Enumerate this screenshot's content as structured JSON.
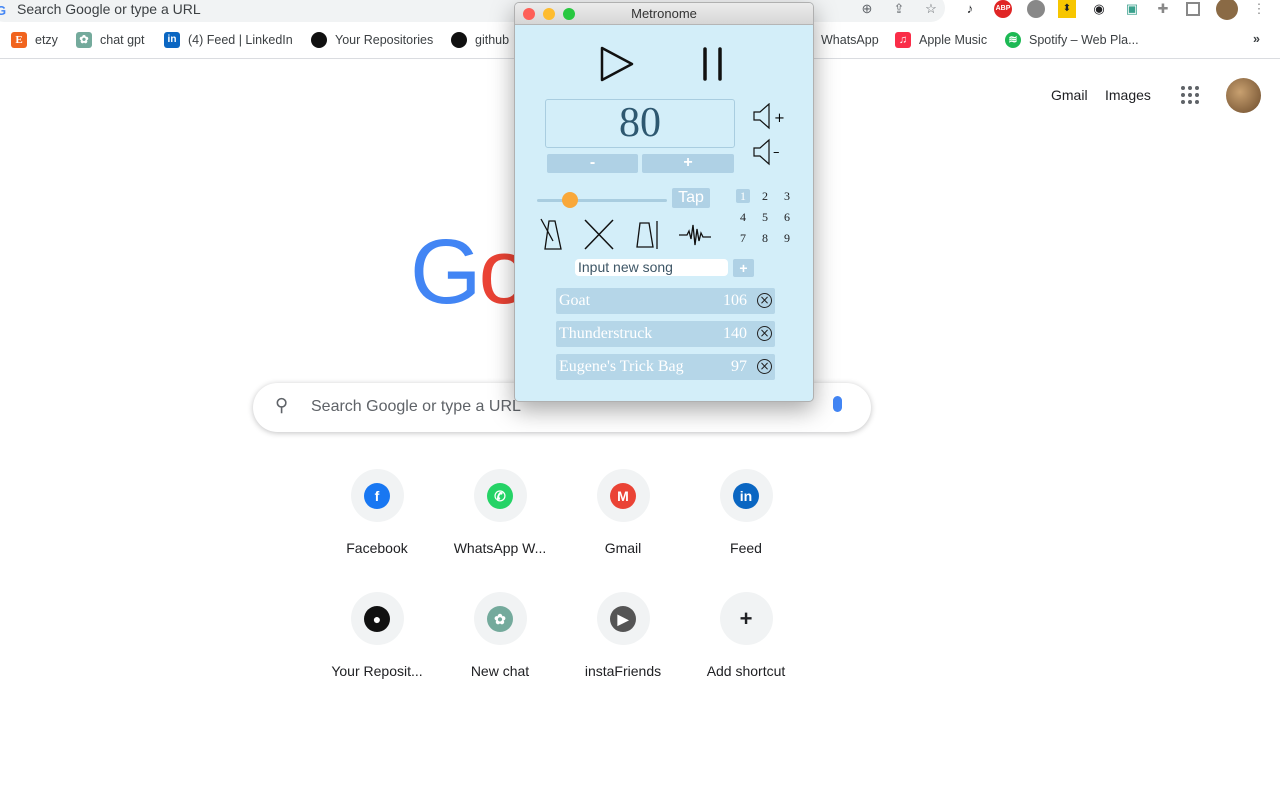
{
  "browser": {
    "omnibox_text": "Search Google or type a URL",
    "bookmarks": [
      {
        "label": "etzy",
        "icon": "etsy-icon",
        "color": "#f1641e"
      },
      {
        "label": "chat gpt",
        "icon": "chatgpt-icon",
        "color": "#74aa9c"
      },
      {
        "label": "(4) Feed | LinkedIn",
        "icon": "linkedin-icon",
        "color": "#0a66c2"
      },
      {
        "label": "Your Repositories",
        "icon": "github-icon",
        "color": "#111"
      },
      {
        "label": "github",
        "icon": "github-icon",
        "color": "#111"
      },
      {
        "label": "WhatsApp",
        "icon": "whatsapp-icon",
        "color": "#25d366"
      },
      {
        "label": "Apple Music",
        "icon": "apple-music-icon",
        "color": "#fa2d48"
      },
      {
        "label": "Spotify – Web Pla...",
        "icon": "spotify-icon",
        "color": "#1db954"
      }
    ],
    "more_bookmarks": "»"
  },
  "google": {
    "gmail": "Gmail",
    "images": "Images",
    "logo": "Google",
    "search_placeholder": "Search Google or type a URL",
    "shortcuts": [
      {
        "label": "Facebook",
        "glyph": "f",
        "color": "#1877f2"
      },
      {
        "label": "WhatsApp W...",
        "glyph": "✆",
        "color": "#25d366"
      },
      {
        "label": "Gmail",
        "glyph": "M",
        "color": "#ea4335"
      },
      {
        "label": "Feed",
        "glyph": "in",
        "color": "#0a66c2"
      },
      {
        "label": "Your Reposit...",
        "glyph": "●",
        "color": "#111"
      },
      {
        "label": "New chat",
        "glyph": "✿",
        "color": "#74aa9c"
      },
      {
        "label": "instaFriends",
        "glyph": "▶",
        "color": "#555"
      },
      {
        "label": "Add shortcut",
        "glyph": "+",
        "color": "#202124"
      }
    ]
  },
  "metronome": {
    "title": "Metronome",
    "bpm": "80",
    "minus": "-",
    "plus": "+",
    "tap": "Tap",
    "slider_level": 0.25,
    "accent": "#f9a83a",
    "beats": [
      "1",
      "2",
      "3",
      "4",
      "5",
      "6",
      "7",
      "8",
      "9"
    ],
    "selected_beat": "1",
    "song_placeholder": "Input new song",
    "add": "+",
    "songs": [
      {
        "name": "Goat",
        "bpm": "106"
      },
      {
        "name": "Thunderstruck",
        "bpm": "140"
      },
      {
        "name": "Eugene's Trick Bag",
        "bpm": "97"
      }
    ]
  }
}
